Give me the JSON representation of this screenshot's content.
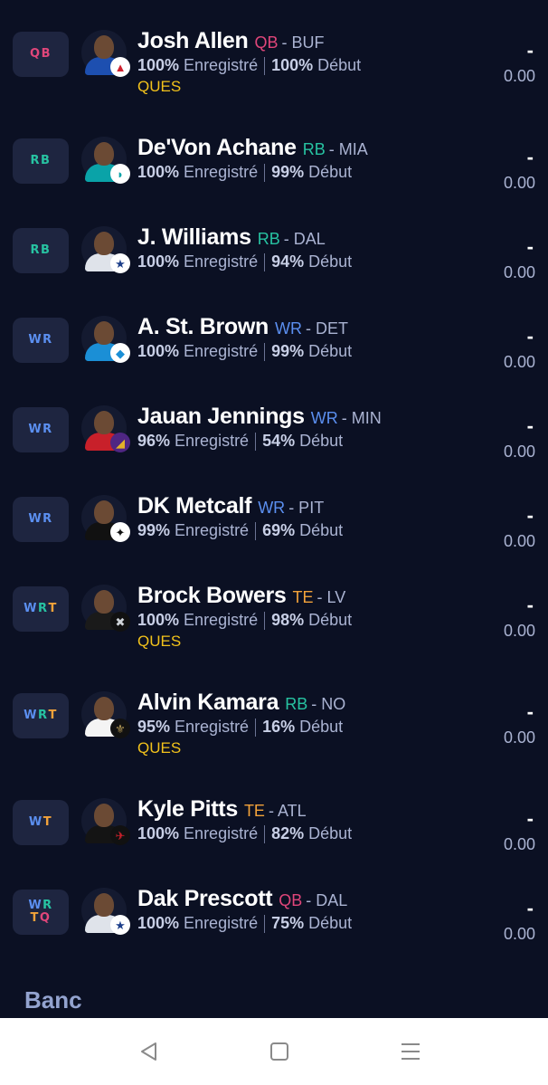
{
  "roster": [
    {
      "slot": [
        [
          "QB",
          "#e0467a"
        ]
      ],
      "name": "Josh Allen",
      "pos": "QB",
      "team": "- BUF",
      "rostered_pct": "100%",
      "rostered_label": "Enregistré",
      "start_pct": "100%",
      "start_label": "Début",
      "status": "QUES",
      "proj_dash": "-",
      "proj_value": "0.00",
      "team_color": "#1d4fb0",
      "badge_icon": "bills-logo-icon"
    },
    {
      "slot": [
        [
          "RB",
          "#27c3a2"
        ]
      ],
      "name": "De'Von Achane",
      "pos": "RB",
      "team": "- MIA",
      "rostered_pct": "100%",
      "rostered_label": "Enregistré",
      "start_pct": "99%",
      "start_label": "Début",
      "status": "",
      "proj_dash": "-",
      "proj_value": "0.00",
      "team_color": "#0aa3a8",
      "badge_icon": "dolphins-logo-icon"
    },
    {
      "slot": [
        [
          "RB",
          "#27c3a2"
        ]
      ],
      "name": "J. Williams",
      "pos": "RB",
      "team": "- DAL",
      "rostered_pct": "100%",
      "rostered_label": "Enregistré",
      "start_pct": "94%",
      "start_label": "Début",
      "status": "",
      "proj_dash": "-",
      "proj_value": "0.00",
      "team_color": "#dfe3ea",
      "badge_icon": "cowboys-star-icon"
    },
    {
      "slot": [
        [
          "WR",
          "#5b8ff0"
        ]
      ],
      "name": "A. St. Brown",
      "pos": "WR",
      "team": "- DET",
      "rostered_pct": "100%",
      "rostered_label": "Enregistré",
      "start_pct": "99%",
      "start_label": "Début",
      "status": "",
      "proj_dash": "-",
      "proj_value": "0.00",
      "team_color": "#1b8fd6",
      "badge_icon": "lions-logo-icon"
    },
    {
      "slot": [
        [
          "WR",
          "#5b8ff0"
        ]
      ],
      "name": "Jauan Jennings",
      "pos": "WR",
      "team": "- MIN",
      "rostered_pct": "96%",
      "rostered_label": "Enregistré",
      "start_pct": "54%",
      "start_label": "Début",
      "status": "",
      "proj_dash": "-",
      "proj_value": "0.00",
      "team_color": "#c8202a",
      "badge_icon": "vikings-logo-icon"
    },
    {
      "slot": [
        [
          "WR",
          "#5b8ff0"
        ]
      ],
      "name": "DK Metcalf",
      "pos": "WR",
      "team": "- PIT",
      "rostered_pct": "99%",
      "rostered_label": "Enregistré",
      "start_pct": "69%",
      "start_label": "Début",
      "status": "",
      "proj_dash": "-",
      "proj_value": "0.00",
      "team_color": "#111111",
      "badge_icon": "steelers-logo-icon"
    },
    {
      "slot": [
        [
          "W",
          "#5b8ff0"
        ],
        [
          "R",
          "#27c3a2"
        ],
        [
          "T",
          "#f2a23a"
        ]
      ],
      "name": "Brock Bowers",
      "pos": "TE",
      "team": "- LV",
      "rostered_pct": "100%",
      "rostered_label": "Enregistré",
      "start_pct": "98%",
      "start_label": "Début",
      "status": "QUES",
      "proj_dash": "-",
      "proj_value": "0.00",
      "team_color": "#1a1a1a",
      "badge_icon": "raiders-logo-icon"
    },
    {
      "slot": [
        [
          "W",
          "#5b8ff0"
        ],
        [
          "R",
          "#27c3a2"
        ],
        [
          "T",
          "#f2a23a"
        ]
      ],
      "name": "Alvin Kamara",
      "pos": "RB",
      "team": "- NO",
      "rostered_pct": "95%",
      "rostered_label": "Enregistré",
      "start_pct": "16%",
      "start_label": "Début",
      "status": "QUES",
      "proj_dash": "-",
      "proj_value": "0.00",
      "team_color": "#f4f4f4",
      "badge_icon": "saints-logo-icon"
    },
    {
      "slot": [
        [
          "W",
          "#5b8ff0"
        ],
        [
          "T",
          "#f2a23a"
        ]
      ],
      "name": "Kyle Pitts",
      "pos": "TE",
      "team": "- ATL",
      "rostered_pct": "100%",
      "rostered_label": "Enregistré",
      "start_pct": "82%",
      "start_label": "Début",
      "status": "",
      "proj_dash": "-",
      "proj_value": "0.00",
      "team_color": "#141414",
      "badge_icon": "falcons-logo-icon"
    },
    {
      "slot": [
        [
          "W",
          "#5b8ff0"
        ],
        [
          "R",
          "#27c3a2"
        ],
        [
          "\n",
          ""
        ],
        [
          "T",
          "#f2a23a"
        ],
        [
          "Q",
          "#e0467a"
        ]
      ],
      "name": "Dak Prescott",
      "pos": "QB",
      "team": "- DAL",
      "rostered_pct": "100%",
      "rostered_label": "Enregistré",
      "start_pct": "75%",
      "start_label": "Début",
      "status": "",
      "proj_dash": "-",
      "proj_value": "0.00",
      "team_color": "#dfe3ea",
      "badge_icon": "cowboys-star-icon"
    }
  ],
  "pos_colors": {
    "QB": "#e0467a",
    "RB": "#27c3a2",
    "WR": "#5b8ff0",
    "TE": "#f2a23a"
  },
  "bench_title": "Banc",
  "nav": {
    "back_icon": "back-triangle-icon",
    "home_icon": "home-square-icon",
    "menu_icon": "menu-lines-icon"
  }
}
